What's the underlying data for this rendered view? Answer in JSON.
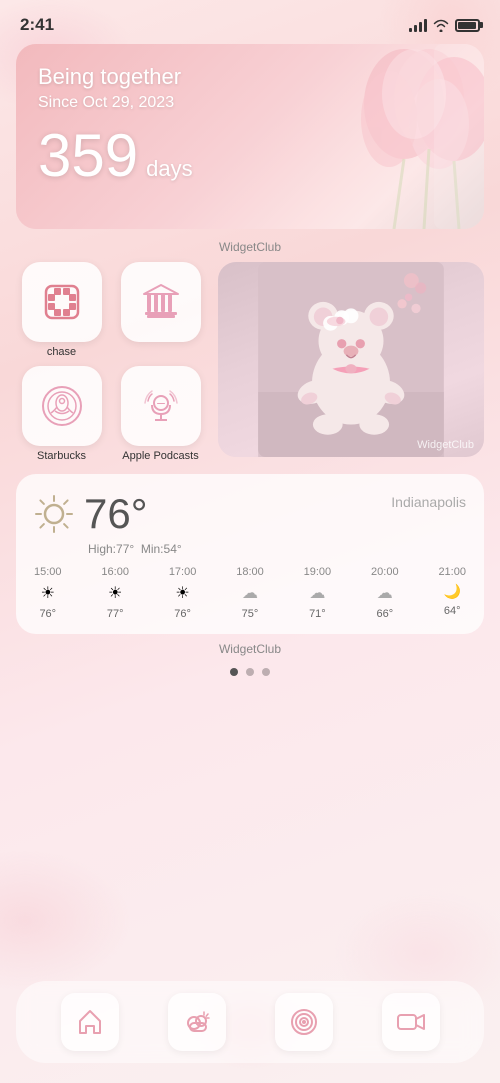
{
  "statusBar": {
    "time": "2:41",
    "signalBars": [
      4,
      7,
      10,
      13
    ],
    "batteryLevel": 85
  },
  "relationshipWidget": {
    "title": "Being together",
    "date": "Since Oct 29, 2023",
    "days": "359",
    "daysLabel": "days",
    "credit": "WidgetClub"
  },
  "apps": {
    "chase": {
      "label": "chase",
      "iconType": "chase"
    },
    "bank": {
      "label": "",
      "iconType": "bank"
    },
    "starbucks": {
      "label": "Starbucks",
      "iconType": "starbucks"
    },
    "podcasts": {
      "label": "Apple Podcasts",
      "iconType": "podcasts"
    },
    "teddyCredit": "WidgetClub"
  },
  "weather": {
    "city": "Indianapolis",
    "temperature": "76°",
    "high": "High:77°",
    "min": "Min:54°",
    "credit": "WidgetClub",
    "forecast": [
      {
        "time": "15:00",
        "icon": "☀",
        "temp": "76°"
      },
      {
        "time": "16:00",
        "icon": "☀",
        "temp": "77°"
      },
      {
        "time": "17:00",
        "icon": "☀",
        "temp": "76°"
      },
      {
        "time": "18:00",
        "icon": "☁",
        "temp": "75°"
      },
      {
        "time": "19:00",
        "icon": "☁",
        "temp": "71°"
      },
      {
        "time": "20:00",
        "icon": "☁",
        "temp": "66°"
      },
      {
        "time": "21:00",
        "icon": "🌙",
        "temp": "64°"
      }
    ]
  },
  "dock": {
    "icons": [
      "home",
      "weather-cloud",
      "target",
      "video-camera"
    ]
  },
  "pageDots": {
    "active": 0,
    "total": 3
  }
}
